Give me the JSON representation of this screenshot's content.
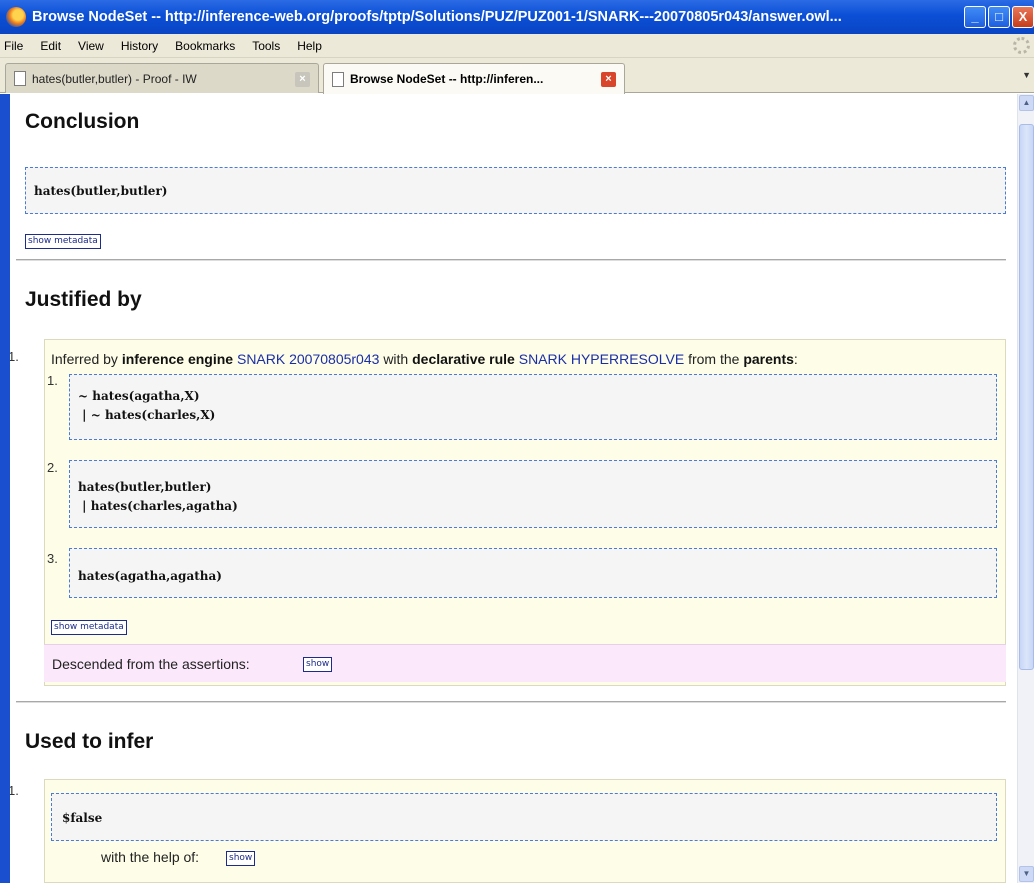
{
  "window": {
    "title": "Browse NodeSet -- http://inference-web.org/proofs/tptp/Solutions/PUZ/PUZ001-1/SNARK---20070805r043/answer.owl...",
    "buttons": [
      "_",
      "□",
      "X"
    ]
  },
  "menu": [
    "File",
    "Edit",
    "View",
    "History",
    "Bookmarks",
    "Tools",
    "Help"
  ],
  "tabs": [
    {
      "label": "hates(butler,butler) - Proof - IW",
      "active": false
    },
    {
      "label": "Browse NodeSet -- http://inferen...",
      "active": true
    }
  ],
  "conclusion": {
    "heading": "Conclusion",
    "formula": "hates(butler,butler)",
    "show_metadata": "show metadata"
  },
  "justified": {
    "heading": "Justified by",
    "item_number": "1.",
    "text_inferred": "Inferred by",
    "text_engine_label": "inference engine",
    "engine": "SNARK 20070805r043",
    "text_with": "with",
    "text_rule_label": "declarative rule",
    "rule": "SNARK HYPERRESOLVE",
    "text_from": "from the",
    "text_parents": "parents",
    "parents": [
      {
        "number": "1.",
        "line1": "~ hates(agatha,X)",
        "line2": " | ~ hates(charles,X)"
      },
      {
        "number": "2.",
        "line1": "hates(butler,butler)",
        "line2": " | hates(charles,agatha)"
      },
      {
        "number": "3.",
        "line1": "hates(agatha,agatha)",
        "line2": ""
      }
    ],
    "show_metadata": "show metadata",
    "descended_label": "Descended from the assertions:",
    "descended_button": "show"
  },
  "used": {
    "heading": "Used to infer",
    "item_number": "1.",
    "formula": "$false",
    "help_label": "with the help of:",
    "help_button": "show"
  },
  "colors": {
    "title_bar": "#0b4fd6",
    "link": "#1a2ea6",
    "panel_yellow": "#fefde8",
    "panel_pink": "#fbe9fb",
    "box_border": "#4b7bd6"
  }
}
